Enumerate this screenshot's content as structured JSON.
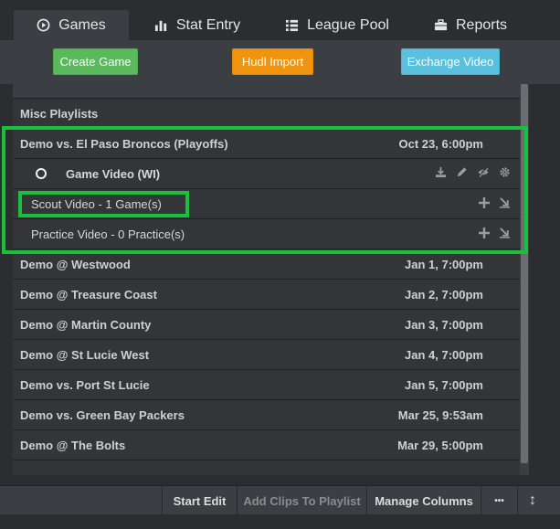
{
  "tabs": [
    {
      "label": "Games",
      "icon": "play-circle-icon",
      "active": true
    },
    {
      "label": "Stat Entry",
      "icon": "bar-chart-icon",
      "active": false
    },
    {
      "label": "League Pool",
      "icon": "list-icon",
      "active": false
    },
    {
      "label": "Reports",
      "icon": "briefcase-icon",
      "active": false
    }
  ],
  "actions": {
    "create_game": "Create Game",
    "hudl_import": "Hudl Import",
    "exchange_video": "Exchange Video"
  },
  "list": {
    "misc_playlists": "Misc Playlists",
    "expanded_game": {
      "title": "Demo vs. El Paso Broncos (Playoffs)",
      "date": "Oct 23, 6:00pm"
    },
    "game_video": "Game Video (WI)",
    "scout_video": "Scout Video - 1 Game(s)",
    "practice_video": "Practice Video - 0 Practice(s)",
    "games": [
      {
        "title": "Demo @ Westwood",
        "date": "Jan 1, 7:00pm"
      },
      {
        "title": "Demo @ Treasure Coast",
        "date": "Jan 2, 7:00pm"
      },
      {
        "title": "Demo @ Martin County",
        "date": "Jan 3, 7:00pm"
      },
      {
        "title": "Demo @ St Lucie West",
        "date": "Jan 4, 7:00pm"
      },
      {
        "title": "Demo vs. Port St Lucie",
        "date": "Jan 5, 7:00pm"
      },
      {
        "title": "Demo vs. Green Bay Packers",
        "date": "Mar 25, 9:53am"
      },
      {
        "title": "Demo @ The Bolts",
        "date": "Mar 29, 5:00pm"
      }
    ]
  },
  "bottom_bar": {
    "start_edit": "Start Edit",
    "add_clips": "Add Clips To Playlist",
    "manage_columns": "Manage Columns",
    "more": "•••",
    "sort": "↕"
  },
  "colors": {
    "highlight": "#18c03b",
    "green_button": "#5cb85c",
    "orange_button": "#f0930e",
    "blue_button": "#5bc0de"
  }
}
